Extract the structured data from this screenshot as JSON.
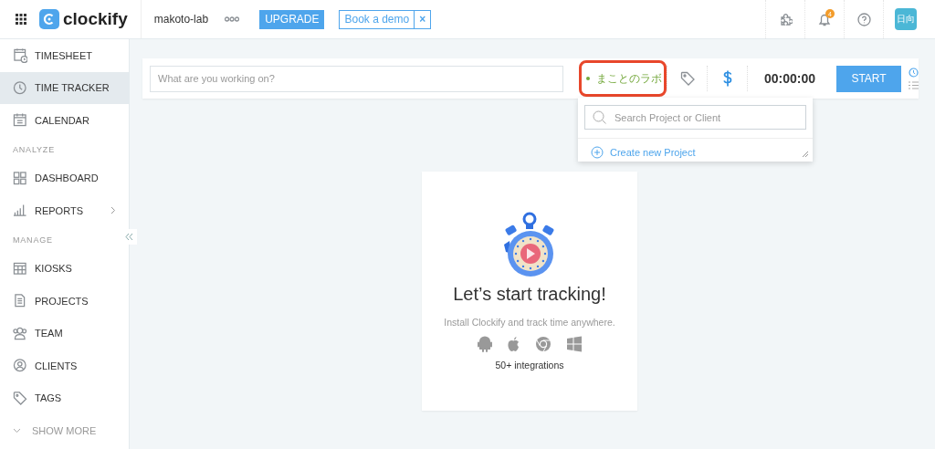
{
  "topbar": {
    "logo": "clockify",
    "workspace": "makoto-lab",
    "upgrade": "UPGRADE",
    "book_demo": "Book a demo",
    "close": "×",
    "notifications": "4",
    "avatar": "日向"
  },
  "sidebar": {
    "items": [
      {
        "kind": "item",
        "label": "TIMESHEET",
        "selected": false
      },
      {
        "kind": "item",
        "label": "TIME TRACKER",
        "selected": true
      },
      {
        "kind": "item",
        "label": "CALENDAR",
        "selected": false
      },
      {
        "kind": "section",
        "label": "ANALYZE"
      },
      {
        "kind": "item",
        "label": "DASHBOARD",
        "selected": false
      },
      {
        "kind": "item",
        "label": "REPORTS",
        "selected": false,
        "submenu": true
      },
      {
        "kind": "section",
        "label": "MANAGE"
      },
      {
        "kind": "item",
        "label": "KIOSKS",
        "selected": false
      },
      {
        "kind": "item",
        "label": "PROJECTS",
        "selected": false
      },
      {
        "kind": "item",
        "label": "TEAM",
        "selected": false
      },
      {
        "kind": "item",
        "label": "CLIENTS",
        "selected": false
      },
      {
        "kind": "item",
        "label": "TAGS",
        "selected": false
      },
      {
        "kind": "more",
        "label": "SHOW MORE"
      }
    ]
  },
  "tracker": {
    "placeholder": "What are you working on?",
    "project": "まことのラボ",
    "highlighted": true,
    "timer": "00:00:00",
    "start": "START"
  },
  "project_dropdown": {
    "search_placeholder": "Search Project or Client",
    "create": "Create new Project"
  },
  "empty_state": {
    "title": "Let’s start tracking!",
    "subtitle": "Install Clockify and track time anywhere.",
    "integrations": "50+ integrations"
  }
}
